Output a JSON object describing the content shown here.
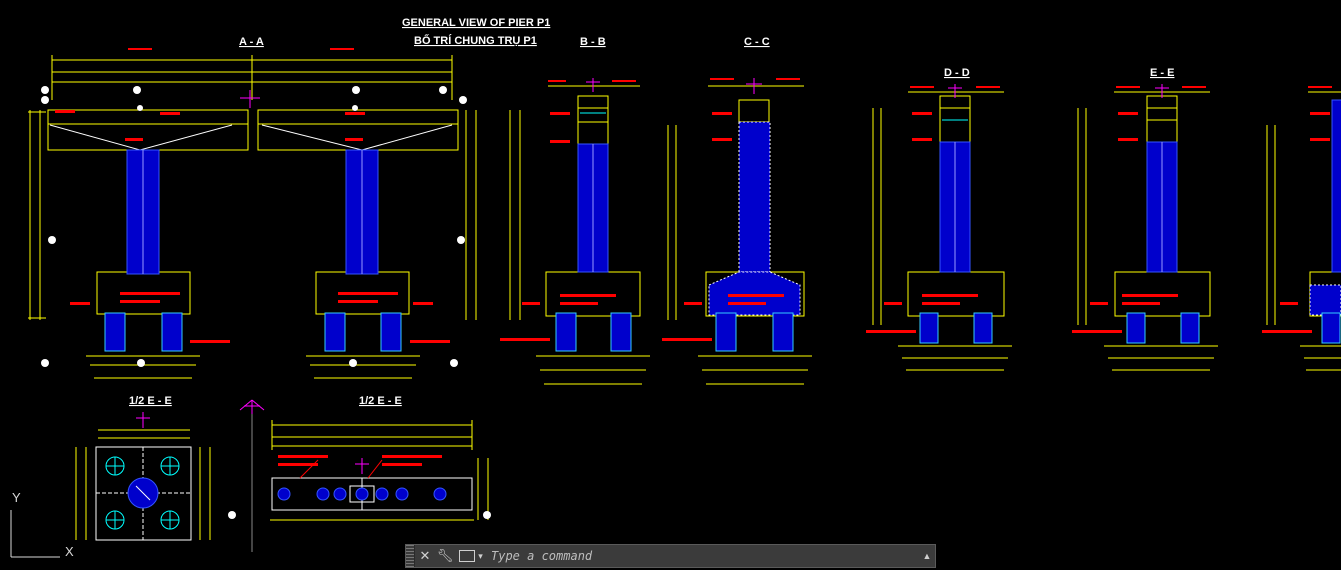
{
  "drawing": {
    "title_line1": "GENERAL VIEW OF PIER P1",
    "title_line2": "BỐ TRÍ CHUNG TRỤ P1",
    "sections": [
      "A - A",
      "B - B",
      "C - C",
      "D - D",
      "E - E"
    ],
    "plan_labels": [
      "1/2 E - E",
      "1/2 E - E"
    ]
  },
  "ucs": {
    "y_label": "Y",
    "x_label": "X"
  },
  "command_line": {
    "placeholder": "Type a command",
    "close_icon": "close-icon",
    "customize_icon": "wrench-icon",
    "prompt_icon": "command-prompt-icon",
    "history_icon": "chevron-up-icon"
  },
  "colors": {
    "background": "#000000",
    "outline": "#ffff00",
    "annotation": "#ff0000",
    "column": "#0000ff",
    "hatch": "#00ffff",
    "marker": "#ff00ff",
    "concrete": "#ffffff"
  }
}
